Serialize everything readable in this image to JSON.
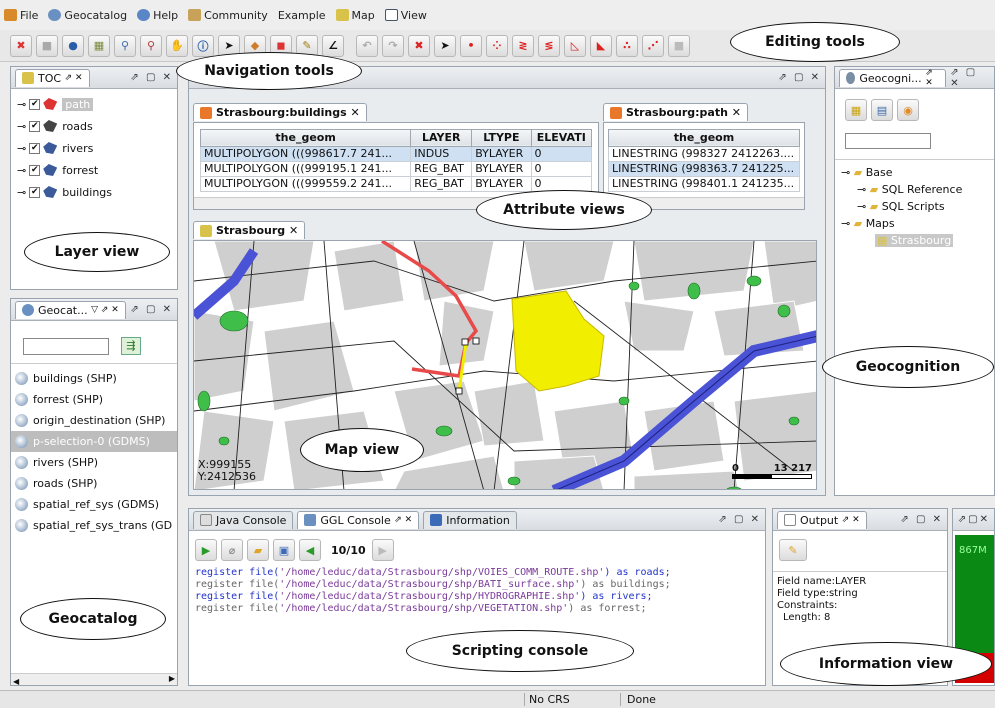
{
  "menu": {
    "file": "File",
    "geocatalog": "Geocatalog",
    "help": "Help",
    "community": "Community",
    "example": "Example",
    "map": "Map",
    "view": "View"
  },
  "toc": {
    "title": "TOC",
    "layers": [
      {
        "name": "path",
        "checked": true,
        "selected": true
      },
      {
        "name": "roads",
        "checked": true
      },
      {
        "name": "rivers",
        "checked": true
      },
      {
        "name": "forrest",
        "checked": true
      },
      {
        "name": "buildings",
        "checked": true
      }
    ]
  },
  "geocatalog": {
    "title": "Geocat...",
    "search_value": "",
    "items": [
      {
        "label": "buildings (SHP)"
      },
      {
        "label": "forrest (SHP)"
      },
      {
        "label": "origin_destination (SHP)"
      },
      {
        "label": "p-selection-0 (GDMS)",
        "selected": true
      },
      {
        "label": "rivers (SHP)"
      },
      {
        "label": "roads (SHP)"
      },
      {
        "label": "spatial_ref_sys (GDMS)"
      },
      {
        "label": "spatial_ref_sys_trans (GD"
      }
    ]
  },
  "buildings_table": {
    "tab": "Strasbourg:buildings",
    "columns": [
      "the_geom",
      "LAYER",
      "LTYPE",
      "ELEVATI"
    ],
    "rows": [
      [
        "MULTIPOLYGON (((998617.7 241...",
        "INDUS",
        "BYLAYER",
        "0"
      ],
      [
        "MULTIPOLYGON (((999195.1 241...",
        "REG_BAT",
        "BYLAYER",
        "0"
      ],
      [
        "MULTIPOLYGON (((999559.2 241...",
        "REG_BAT",
        "BYLAYER",
        "0"
      ]
    ]
  },
  "path_table": {
    "tab": "Strasbourg:path",
    "columns": [
      "the_geom"
    ],
    "rows": [
      [
        "LINESTRING (998327 2412263...."
      ],
      [
        "LINESTRING (998363.7 241225..."
      ],
      [
        "LINESTRING (998401.1 241235..."
      ]
    ]
  },
  "map": {
    "tab": "Strasbourg",
    "x": "X:999155",
    "y": "Y:2412536",
    "scale_min": "0",
    "scale_max": "13 217"
  },
  "geocognition": {
    "title": "Geocogni...",
    "search_value": "",
    "tree": {
      "base": "Base",
      "sql_reference": "SQL Reference",
      "sql_scripts": "SQL Scripts",
      "maps": "Maps",
      "strasbourg": "Strasbourg"
    }
  },
  "console": {
    "tabs": [
      "Java Console",
      "GGL Console",
      "Information"
    ],
    "counter": "10/10",
    "lines": [
      {
        "kw": "register file(",
        "str": "'/home/leduc/data/Strasbourg/shp/VOIES_COMM_ROUTE.shp'",
        "tail": ") as roads;"
      },
      {
        "kw": "register file(",
        "str": "'/home/leduc/data/Strasbourg/shp/BATI_surface.shp'",
        "tail": ") as buildings;"
      },
      {
        "kw": "register file(",
        "str": "'/home/leduc/data/Strasbourg/shp/HYDROGRAPHIE.shp'",
        "tail": ") as rivers;"
      },
      {
        "kw": "register file(",
        "str": "'/home/leduc/data/Strasbourg/shp/VEGETATION.shp'",
        "tail": ") as forrest;"
      }
    ]
  },
  "output": {
    "title": "Output",
    "field_name": "Field name:LAYER",
    "field_type": "Field type:string",
    "constraints": "Constraints:",
    "length": "Length: 8",
    "side_value": "867M"
  },
  "status": {
    "crs": "No CRS",
    "state": "Done"
  },
  "callouts": {
    "editing_tools": "Editing tools",
    "navigation_tools": "Navigation tools",
    "layer_view": "Layer view",
    "attribute_views": "Attribute views",
    "geocognition": "Geocognition",
    "map_view": "Map view",
    "geocatalog": "Geocatalog",
    "scripting_console": "Scripting console",
    "information_view": "Information view"
  },
  "colors": {
    "river": "#4a52d6",
    "forest": "#3fbf4a",
    "path": "#e84a4a",
    "selection": "#f2ee00",
    "buildings": "#c9c9c9"
  }
}
